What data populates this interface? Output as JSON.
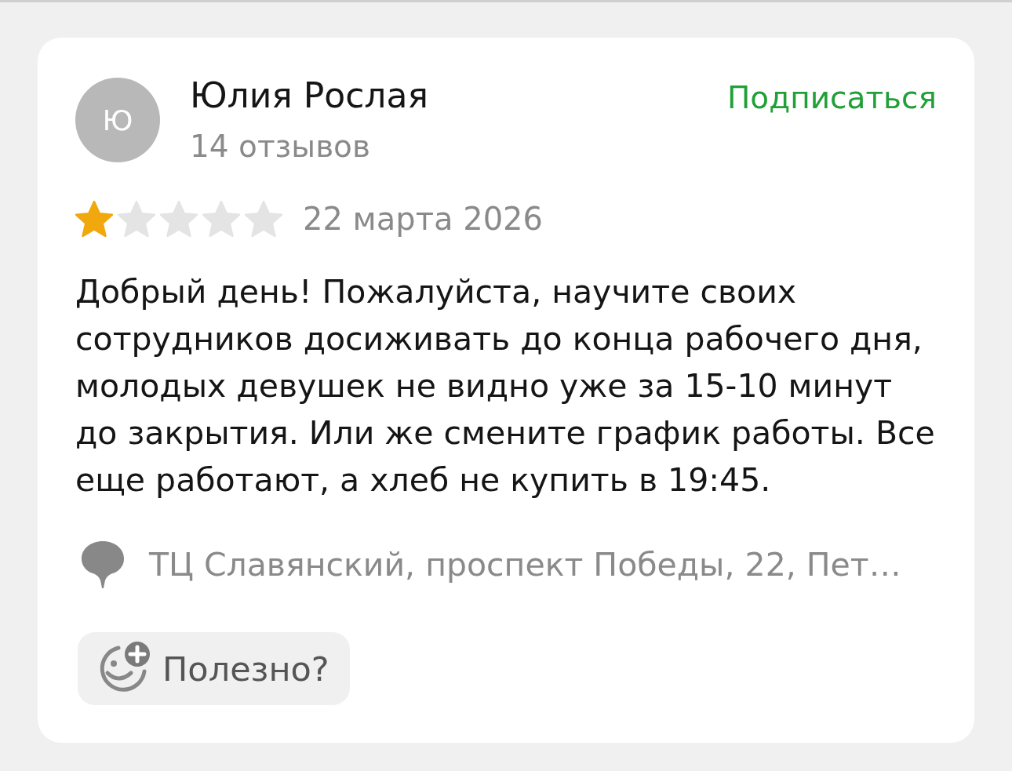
{
  "review": {
    "author": {
      "initial": "Ю",
      "name": "Юлия Рослая",
      "reviews_count": "14 отзывов"
    },
    "subscribe": "Подписаться",
    "rating": {
      "stars": 1
    },
    "date": "22 марта 2026",
    "text": "Добрый день! Пожалуйста, научите своих сотрудников досиживать до конца рабочего дня, молодых девушек не видно уже за 15-10 минут до закрытия. Или же смените график работы. Все еще работают, а хлеб не купить в 19:45.",
    "location": "ТЦ Славянский, проспект Победы, 22, Пет…",
    "helpful_button": "Полезно?"
  }
}
